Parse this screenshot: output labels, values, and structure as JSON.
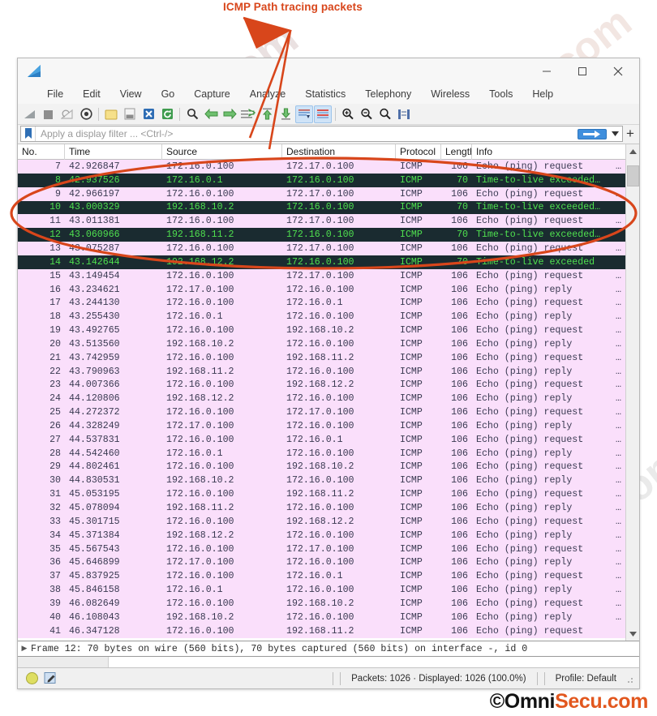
{
  "annotation": {
    "title": "ICMP Path tracing packets",
    "color": "#D8461B"
  },
  "brand": {
    "black_part": "©Omni",
    "orange_part": "Secu.com"
  },
  "watermark_text": "OmniSecu.com",
  "window": {
    "logo": "wireshark-shark-fin-icon",
    "controls": {
      "minimize": "minimize-icon",
      "maximize": "maximize-icon",
      "close": "close-icon"
    },
    "menu": [
      "File",
      "Edit",
      "View",
      "Go",
      "Capture",
      "Analyze",
      "Statistics",
      "Telephony",
      "Wireless",
      "Tools",
      "Help"
    ],
    "toolbar_icons": [
      "start-capture-icon",
      "stop-capture-icon",
      "restart-capture-icon",
      "capture-options-icon",
      "open-file-icon",
      "save-file-icon",
      "close-file-icon",
      "reload-file-icon",
      "find-packet-icon",
      "go-back-icon",
      "go-forward-icon",
      "go-to-packet-icon",
      "go-to-first-packet-icon",
      "go-to-last-packet-icon",
      "auto-scroll-icon",
      "colorize-packets-icon",
      "zoom-in-icon",
      "zoom-out-icon",
      "zoom-reset-icon",
      "resize-columns-icon"
    ]
  },
  "filter": {
    "bookmark_icon": "bookmark-icon",
    "placeholder": "Apply a display filter ... <Ctrl-/>",
    "value": "",
    "apply_icon": "arrow-right-icon",
    "dropdown_icon": "chevron-down-icon",
    "add_icon": "plus-icon"
  },
  "packet_list": {
    "columns": [
      "No.",
      "Time",
      "Source",
      "Destination",
      "Protocol",
      "Length",
      "Info"
    ],
    "rows": [
      {
        "no": "7",
        "time": "42.926847",
        "src": "172.16.0.100",
        "dst": "172.17.0.100",
        "proto": "ICMP",
        "len": "106",
        "info": "Echo (ping) request",
        "ell": "…",
        "style": "pink"
      },
      {
        "no": "8",
        "time": "42.937526",
        "src": "172.16.0.1",
        "dst": "172.16.0.100",
        "proto": "ICMP",
        "len": "70",
        "info": "Time-to-live exceeded…",
        "ell": "",
        "style": "dark"
      },
      {
        "no": "9",
        "time": "42.966197",
        "src": "172.16.0.100",
        "dst": "172.17.0.100",
        "proto": "ICMP",
        "len": "106",
        "info": "Echo (ping) request",
        "ell": "…",
        "style": "pink"
      },
      {
        "no": "10",
        "time": "43.000329",
        "src": "192.168.10.2",
        "dst": "172.16.0.100",
        "proto": "ICMP",
        "len": "70",
        "info": "Time-to-live exceeded…",
        "ell": "",
        "style": "dark"
      },
      {
        "no": "11",
        "time": "43.011381",
        "src": "172.16.0.100",
        "dst": "172.17.0.100",
        "proto": "ICMP",
        "len": "106",
        "info": "Echo (ping) request",
        "ell": "…",
        "style": "pink"
      },
      {
        "no": "12",
        "time": "43.060966",
        "src": "192.168.11.2",
        "dst": "172.16.0.100",
        "proto": "ICMP",
        "len": "70",
        "info": "Time-to-live exceeded…",
        "ell": "",
        "style": "dark"
      },
      {
        "no": "13",
        "time": "43.075287",
        "src": "172.16.0.100",
        "dst": "172.17.0.100",
        "proto": "ICMP",
        "len": "106",
        "info": "Echo (ping) request",
        "ell": "…",
        "style": "pink"
      },
      {
        "no": "14",
        "time": "43.142644",
        "src": "192.168.12.2",
        "dst": "172.16.0.100",
        "proto": "ICMP",
        "len": "70",
        "info": "Time-to-live exceeded",
        "ell": "",
        "style": "dark"
      },
      {
        "no": "15",
        "time": "43.149454",
        "src": "172.16.0.100",
        "dst": "172.17.0.100",
        "proto": "ICMP",
        "len": "106",
        "info": "Echo (ping) request",
        "ell": "…",
        "style": "pink"
      },
      {
        "no": "16",
        "time": "43.234621",
        "src": "172.17.0.100",
        "dst": "172.16.0.100",
        "proto": "ICMP",
        "len": "106",
        "info": "Echo (ping) reply",
        "ell": "…",
        "style": "pink"
      },
      {
        "no": "17",
        "time": "43.244130",
        "src": "172.16.0.100",
        "dst": "172.16.0.1",
        "proto": "ICMP",
        "len": "106",
        "info": "Echo (ping) request",
        "ell": "…",
        "style": "pink"
      },
      {
        "no": "18",
        "time": "43.255430",
        "src": "172.16.0.1",
        "dst": "172.16.0.100",
        "proto": "ICMP",
        "len": "106",
        "info": "Echo (ping) reply",
        "ell": "…",
        "style": "pink"
      },
      {
        "no": "19",
        "time": "43.492765",
        "src": "172.16.0.100",
        "dst": "192.168.10.2",
        "proto": "ICMP",
        "len": "106",
        "info": "Echo (ping) request",
        "ell": "…",
        "style": "pink"
      },
      {
        "no": "20",
        "time": "43.513560",
        "src": "192.168.10.2",
        "dst": "172.16.0.100",
        "proto": "ICMP",
        "len": "106",
        "info": "Echo (ping) reply",
        "ell": "…",
        "style": "pink"
      },
      {
        "no": "21",
        "time": "43.742959",
        "src": "172.16.0.100",
        "dst": "192.168.11.2",
        "proto": "ICMP",
        "len": "106",
        "info": "Echo (ping) request",
        "ell": "…",
        "style": "pink"
      },
      {
        "no": "22",
        "time": "43.790963",
        "src": "192.168.11.2",
        "dst": "172.16.0.100",
        "proto": "ICMP",
        "len": "106",
        "info": "Echo (ping) reply",
        "ell": "…",
        "style": "pink"
      },
      {
        "no": "23",
        "time": "44.007366",
        "src": "172.16.0.100",
        "dst": "192.168.12.2",
        "proto": "ICMP",
        "len": "106",
        "info": "Echo (ping) request",
        "ell": "…",
        "style": "pink"
      },
      {
        "no": "24",
        "time": "44.120806",
        "src": "192.168.12.2",
        "dst": "172.16.0.100",
        "proto": "ICMP",
        "len": "106",
        "info": "Echo (ping) reply",
        "ell": "…",
        "style": "pink"
      },
      {
        "no": "25",
        "time": "44.272372",
        "src": "172.16.0.100",
        "dst": "172.17.0.100",
        "proto": "ICMP",
        "len": "106",
        "info": "Echo (ping) request",
        "ell": "…",
        "style": "pink"
      },
      {
        "no": "26",
        "time": "44.328249",
        "src": "172.17.0.100",
        "dst": "172.16.0.100",
        "proto": "ICMP",
        "len": "106",
        "info": "Echo (ping) reply",
        "ell": "…",
        "style": "pink"
      },
      {
        "no": "27",
        "time": "44.537831",
        "src": "172.16.0.100",
        "dst": "172.16.0.1",
        "proto": "ICMP",
        "len": "106",
        "info": "Echo (ping) request",
        "ell": "…",
        "style": "pink"
      },
      {
        "no": "28",
        "time": "44.542460",
        "src": "172.16.0.1",
        "dst": "172.16.0.100",
        "proto": "ICMP",
        "len": "106",
        "info": "Echo (ping) reply",
        "ell": "…",
        "style": "pink"
      },
      {
        "no": "29",
        "time": "44.802461",
        "src": "172.16.0.100",
        "dst": "192.168.10.2",
        "proto": "ICMP",
        "len": "106",
        "info": "Echo (ping) request",
        "ell": "…",
        "style": "pink"
      },
      {
        "no": "30",
        "time": "44.830531",
        "src": "192.168.10.2",
        "dst": "172.16.0.100",
        "proto": "ICMP",
        "len": "106",
        "info": "Echo (ping) reply",
        "ell": "…",
        "style": "pink"
      },
      {
        "no": "31",
        "time": "45.053195",
        "src": "172.16.0.100",
        "dst": "192.168.11.2",
        "proto": "ICMP",
        "len": "106",
        "info": "Echo (ping) request",
        "ell": "…",
        "style": "pink"
      },
      {
        "no": "32",
        "time": "45.078094",
        "src": "192.168.11.2",
        "dst": "172.16.0.100",
        "proto": "ICMP",
        "len": "106",
        "info": "Echo (ping) reply",
        "ell": "…",
        "style": "pink"
      },
      {
        "no": "33",
        "time": "45.301715",
        "src": "172.16.0.100",
        "dst": "192.168.12.2",
        "proto": "ICMP",
        "len": "106",
        "info": "Echo (ping) request",
        "ell": "…",
        "style": "pink"
      },
      {
        "no": "34",
        "time": "45.371384",
        "src": "192.168.12.2",
        "dst": "172.16.0.100",
        "proto": "ICMP",
        "len": "106",
        "info": "Echo (ping) reply",
        "ell": "…",
        "style": "pink"
      },
      {
        "no": "35",
        "time": "45.567543",
        "src": "172.16.0.100",
        "dst": "172.17.0.100",
        "proto": "ICMP",
        "len": "106",
        "info": "Echo (ping) request",
        "ell": "…",
        "style": "pink"
      },
      {
        "no": "36",
        "time": "45.646899",
        "src": "172.17.0.100",
        "dst": "172.16.0.100",
        "proto": "ICMP",
        "len": "106",
        "info": "Echo (ping) reply",
        "ell": "…",
        "style": "pink"
      },
      {
        "no": "37",
        "time": "45.837925",
        "src": "172.16.0.100",
        "dst": "172.16.0.1",
        "proto": "ICMP",
        "len": "106",
        "info": "Echo (ping) request",
        "ell": "…",
        "style": "pink"
      },
      {
        "no": "38",
        "time": "45.846158",
        "src": "172.16.0.1",
        "dst": "172.16.0.100",
        "proto": "ICMP",
        "len": "106",
        "info": "Echo (ping) reply",
        "ell": "…",
        "style": "pink"
      },
      {
        "no": "39",
        "time": "46.082649",
        "src": "172.16.0.100",
        "dst": "192.168.10.2",
        "proto": "ICMP",
        "len": "106",
        "info": "Echo (ping) request",
        "ell": "…",
        "style": "pink"
      },
      {
        "no": "40",
        "time": "46.108043",
        "src": "192.168.10.2",
        "dst": "172.16.0.100",
        "proto": "ICMP",
        "len": "106",
        "info": "Echo (ping) reply",
        "ell": "…",
        "style": "pink"
      },
      {
        "no": "41",
        "time": "46.347128",
        "src": "172.16.0.100",
        "dst": "192.168.11.2",
        "proto": "ICMP",
        "len": "106",
        "info": "Echo (ping) request",
        "ell": "",
        "style": "pink"
      }
    ]
  },
  "detail_pane": {
    "expand_icon": "expand-triangle-icon",
    "text": "Frame 12: 70 bytes on wire (560 bits), 70 bytes captured (560 bits) on interface -, id 0"
  },
  "status_bar": {
    "expert_icon": "expert-info-icon",
    "capture_comment_icon": "capture-comment-icon",
    "packets": "Packets: 1026 · Displayed: 1026 (100.0%)",
    "profile": "Profile: Default"
  }
}
